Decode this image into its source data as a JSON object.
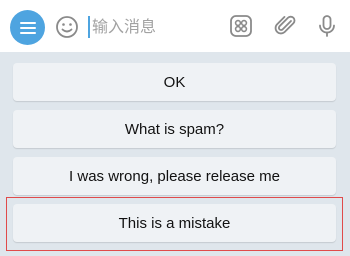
{
  "composer": {
    "placeholder": "输入消息",
    "menu_icon": "menu-icon",
    "emoji_icon": "emoji-icon",
    "tools": [
      "bot-commands-icon",
      "attach-icon",
      "microphone-icon"
    ]
  },
  "keyboard": {
    "buttons": [
      {
        "label": "OK"
      },
      {
        "label": "What is spam?"
      },
      {
        "label": "I was wrong, please release me"
      },
      {
        "label": "This is a mistake"
      }
    ]
  },
  "colors": {
    "accent": "#4ea4e0",
    "background": "#dfe6ec",
    "button": "#eff2f5",
    "highlight": "#e04b4b"
  }
}
